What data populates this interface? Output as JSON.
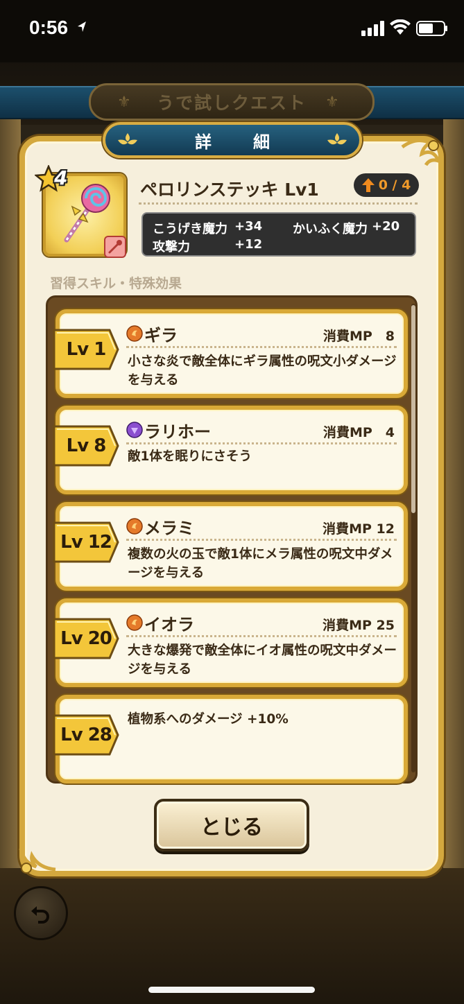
{
  "status_bar": {
    "time": "0:56"
  },
  "background": {
    "quest_title": "うで試しクエスト"
  },
  "dialog": {
    "title": "詳　細",
    "item": {
      "rarity": "4",
      "name": "ペロリンステッキ Lv1",
      "upgrade": "0 / 4",
      "stats": [
        {
          "label": "こうげき魔力",
          "value": "+34"
        },
        {
          "label": "かいふく魔力",
          "value": "+20"
        },
        {
          "label": "攻撃力",
          "value": "+12"
        }
      ]
    },
    "section_label": "習得スキル・特殊効果",
    "skills": [
      {
        "level": "Lv 1",
        "icon": "fire-orb-icon",
        "name": "ギラ",
        "mp": "消費MP　8",
        "description": "小さな炎で敵全体にギラ属性の呪文小ダメージを与える"
      },
      {
        "level": "Lv 8",
        "icon": "purple-orb-icon",
        "name": "ラリホー",
        "mp": "消費MP　4",
        "description": "敵1体を眠りにさそう"
      },
      {
        "level": "Lv 12",
        "icon": "fire-orb-icon",
        "name": "メラミ",
        "mp": "消費MP 12",
        "description": "複数の火の玉で敵1体にメラ属性の呪文中ダメージを与える"
      },
      {
        "level": "Lv 20",
        "icon": "fire-orb-icon",
        "name": "イオラ",
        "mp": "消費MP 25",
        "description": "大きな爆発で敵全体にイオ属性の呪文中ダメージを与える"
      },
      {
        "level": "Lv 28",
        "description": "植物系へのダメージ +10%"
      }
    ],
    "close_label": "とじる"
  },
  "colors": {
    "gold_frame": "#d4a83e",
    "panel": "#f6efdc",
    "list_bg": "#6a4a22",
    "tab_blue": "#1b4d6a"
  }
}
